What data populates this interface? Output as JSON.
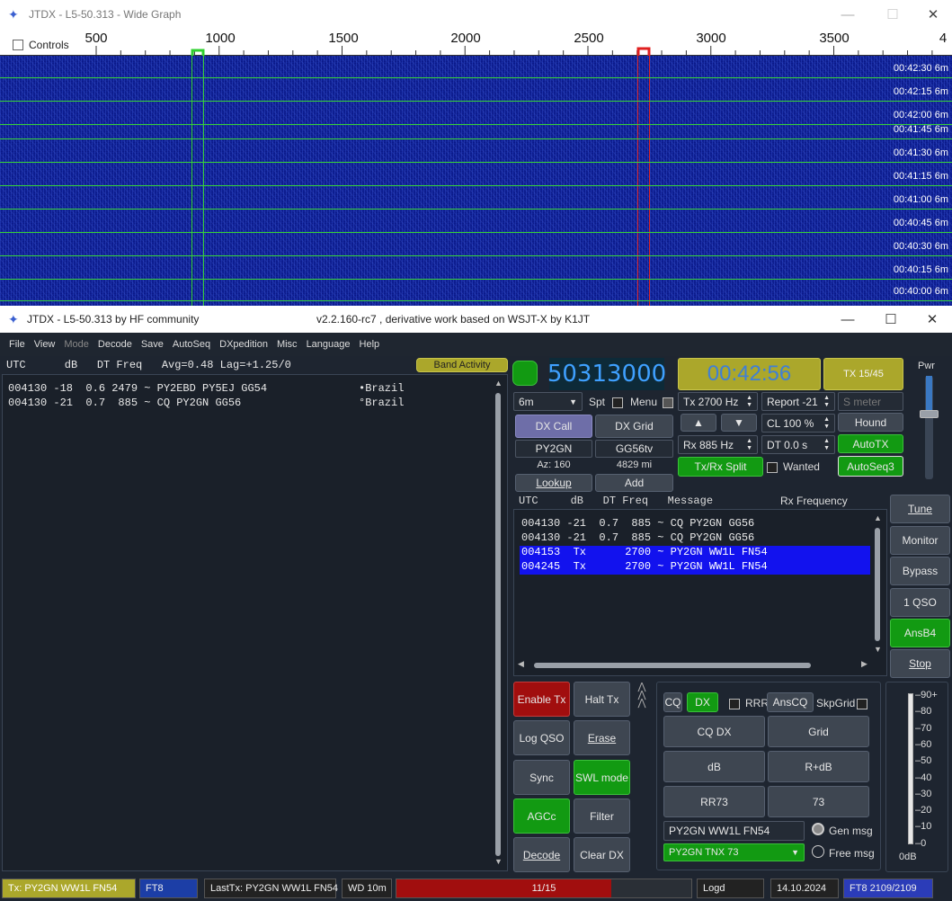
{
  "wide": {
    "title": "JTDX - L5-50.313 - Wide Graph",
    "controls": "Controls",
    "freq_ticks": [
      "500",
      "1000",
      "1500",
      "2000",
      "2500",
      "3000",
      "3500",
      "4"
    ],
    "times": [
      "00:42:30",
      "00:42:15",
      "00:42:00",
      "00:41:45",
      "00:41:30",
      "00:41:15",
      "00:41:00",
      "00:40:45",
      "00:40:30",
      "00:40:15",
      "00:40:00"
    ],
    "band": "6m"
  },
  "main": {
    "title": "JTDX - L5-50.313  by HF community",
    "version": "v2.2.160-rc7 , derivative work based on WSJT-X by K1JT"
  },
  "menu": [
    "File",
    "View",
    "Mode",
    "Decode",
    "Save",
    "AutoSeq",
    "DXpedition",
    "Misc",
    "Language",
    "Help"
  ],
  "band_activity": {
    "header": "UTC      dB   DT Freq   Avg=0.48 Lag=+1.25/0",
    "button": "Band Activity",
    "rows": [
      {
        "text": "004130 -18  0.6 2479 ~ PY2EBD PY5EJ GG54",
        "country": "•Brazil"
      },
      {
        "text": "004130 -21  0.7  885 ~ CQ PY2GN GG56",
        "country": "°Brazil"
      }
    ]
  },
  "controls": {
    "frequency": "50313000",
    "clock": "00:42:56",
    "tx_period": "TX 15/45",
    "pwr": "Pwr",
    "band": "6m",
    "spt": "Spt",
    "menu": "Menu",
    "tx_hz": "Tx  2700  Hz",
    "report": "Report -21",
    "smeter": "S meter",
    "cl": "CL  100 %",
    "hound": "Hound",
    "rx_hz": "Rx  885  Hz",
    "dt": "DT 0.0 s",
    "autotx": "AutoTX",
    "dx_call_btn": "DX Call",
    "dx_grid_btn": "DX Grid",
    "dx_call": "PY2GN",
    "dx_grid": "GG56tv",
    "az": "Az: 160",
    "dist": "4829 mi",
    "lookup": "Lookup",
    "add": "Add",
    "txrx_split": "Tx/Rx Split",
    "wanted": "Wanted",
    "autoseq3": "AutoSeq3"
  },
  "rxfreq": {
    "header": "UTC     dB   DT Freq   Message",
    "rx_label": "Rx Frequency",
    "rows": [
      {
        "text": "004130 -21  0.7  885 ~ CQ PY2GN GG56",
        "tx": false
      },
      {
        "text": "004130 -21  0.7  885 ~ CQ PY2GN GG56",
        "tx": false
      },
      {
        "text": "004153  Tx      2700 ~ PY2GN WW1L FN54",
        "tx": true
      },
      {
        "text": "004245  Tx      2700 ~ PY2GN WW1L FN54",
        "tx": true
      }
    ]
  },
  "side": {
    "tune": "Tune",
    "monitor": "Monitor",
    "bypass": "Bypass",
    "one_qso": "1 QSO",
    "ansb4": "AnsB4",
    "stop": "Stop"
  },
  "bottom": {
    "enable_tx": "Enable Tx",
    "halt_tx": "Halt Tx",
    "log_qso": "Log QSO",
    "erase": "Erase",
    "sync": "Sync",
    "swl": "SWL mode",
    "agcc": "AGCc",
    "filter": "Filter",
    "decode": "Decode",
    "clear_dx": "Clear DX"
  },
  "tx": {
    "cq": "CQ",
    "dx": "DX",
    "rrr": "RRR",
    "anscq": "AnsCQ",
    "skpgrid": "SkpGrid",
    "cq_dx": "CQ DX",
    "grid": "Grid",
    "db": "dB",
    "rdb": "R+dB",
    "rr73": "RR73",
    "s73": "73",
    "gen_text": "PY2GN WW1L FN54",
    "gen_msg": "Gen msg",
    "free_text": "PY2GN TNX 73",
    "free_msg": "Free msg"
  },
  "meter": {
    "labels": [
      "90+",
      "80",
      "70",
      "60",
      "50",
      "40",
      "30",
      "20",
      "10",
      "0"
    ],
    "unit": "0dB"
  },
  "status": {
    "tx": "Tx: PY2GN WW1L FN54",
    "mode": "FT8",
    "lasttx": "LastTx: PY2GN WW1L FN54",
    "wd": "WD 10m",
    "progress": "11/15",
    "progress_value": 0.73,
    "logd": "Logd",
    "date": "14.10.2024",
    "ft8count": "FT8  2109/2109"
  }
}
